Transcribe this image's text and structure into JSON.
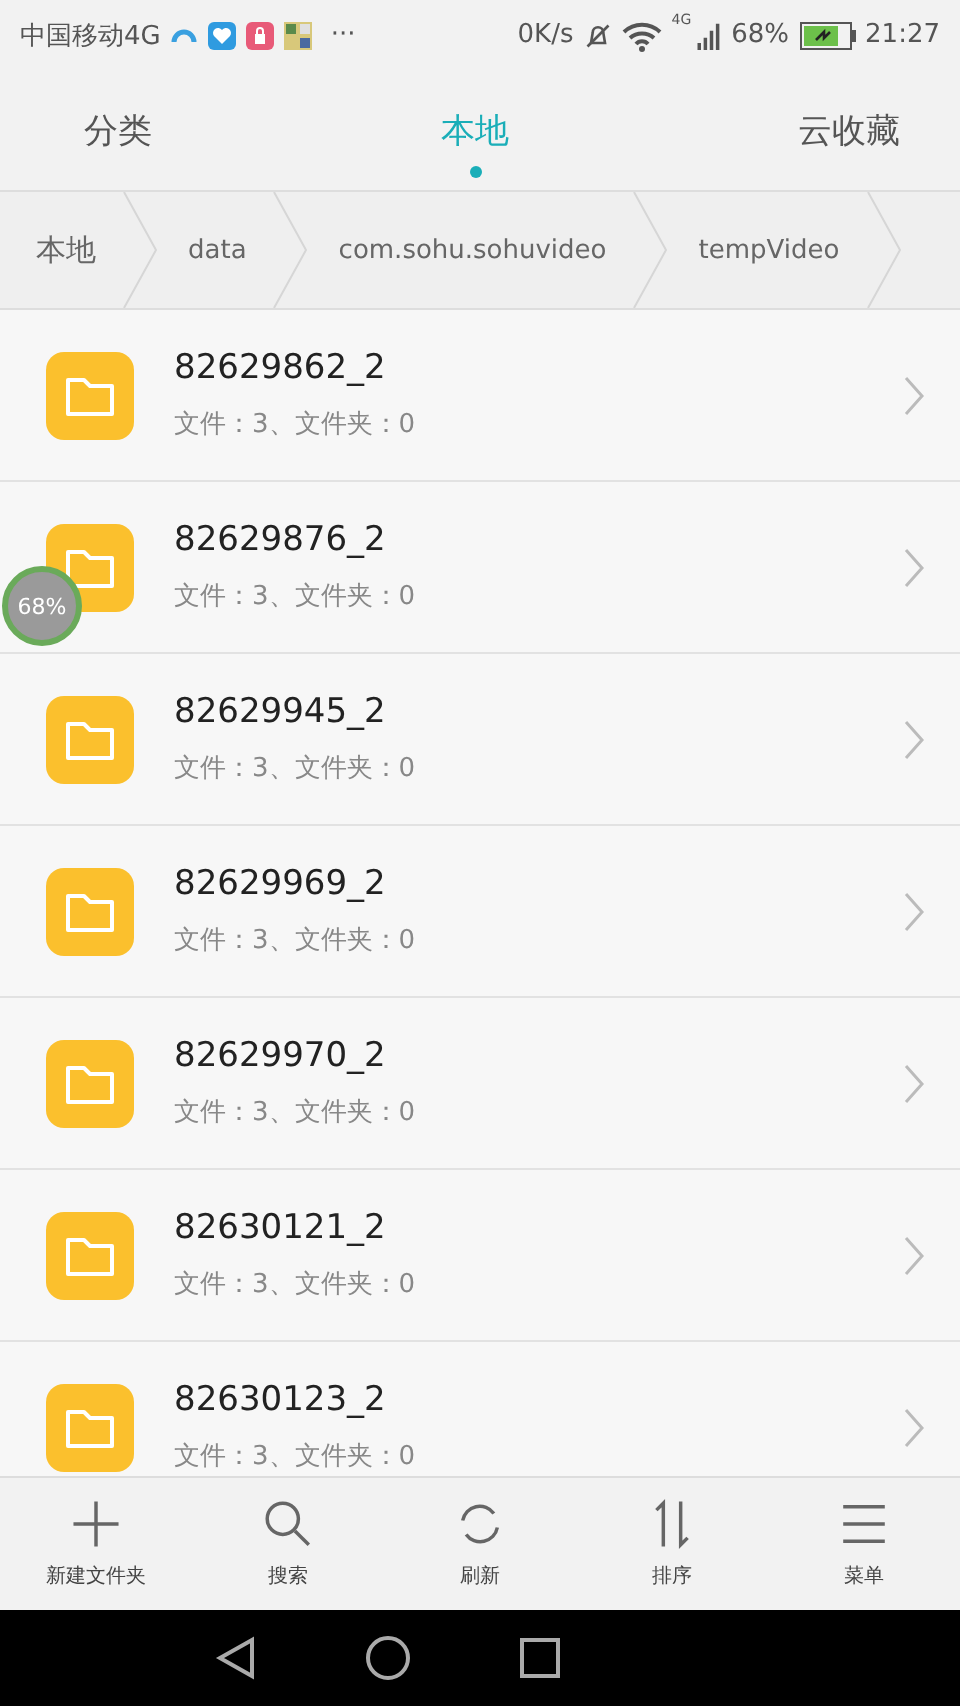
{
  "status_bar": {
    "carrier": "中国移动4G",
    "more": "···",
    "speed": "0K/s",
    "network": "4G",
    "battery": "68%",
    "time": "21:27"
  },
  "tabs": [
    {
      "label": "分类",
      "selected": false
    },
    {
      "label": "本地",
      "selected": true
    },
    {
      "label": "云收藏",
      "selected": false
    }
  ],
  "breadcrumb": [
    "本地",
    "data",
    "com.sohu.sohuvideo",
    "tempVideo"
  ],
  "folders": [
    {
      "name": "82629862_2",
      "info": "文件：3、文件夹：0"
    },
    {
      "name": "82629876_2",
      "info": "文件：3、文件夹：0"
    },
    {
      "name": "82629945_2",
      "info": "文件：3、文件夹：0"
    },
    {
      "name": "82629969_2",
      "info": "文件：3、文件夹：0"
    },
    {
      "name": "82629970_2",
      "info": "文件：3、文件夹：0"
    },
    {
      "name": "82630121_2",
      "info": "文件：3、文件夹：0"
    },
    {
      "name": "82630123_2",
      "info": "文件：3、文件夹：0"
    }
  ],
  "floating_badge": "68%",
  "toolbar": [
    {
      "kind": "add",
      "label": "新建文件夹"
    },
    {
      "kind": "search",
      "label": "搜索"
    },
    {
      "kind": "refresh",
      "label": "刷新"
    },
    {
      "kind": "sort",
      "label": "排序"
    },
    {
      "kind": "menu",
      "label": "菜单"
    }
  ]
}
